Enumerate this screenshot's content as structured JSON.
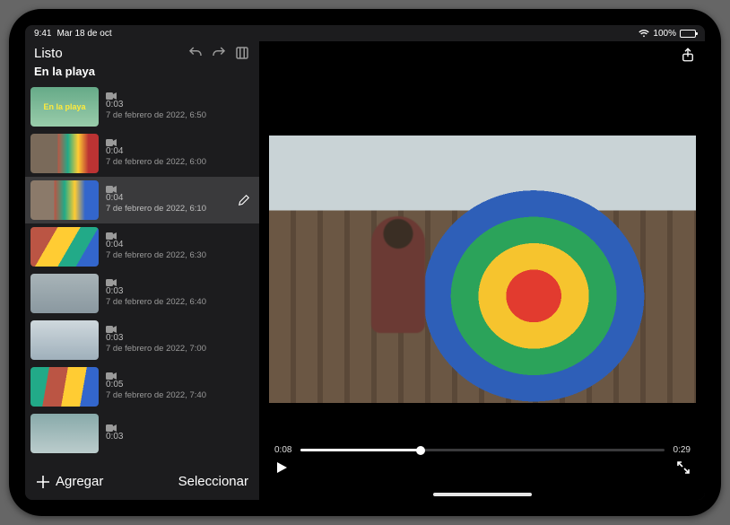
{
  "status": {
    "time": "9:41",
    "date": "Mar 18 de oct",
    "battery": "100%"
  },
  "sidebar": {
    "back_label": "Listo",
    "project_title": "En la playa",
    "add_label": "Agregar",
    "select_label": "Seleccionar",
    "clips": [
      {
        "duration": "0:03",
        "date": "7 de febrero de 2022, 6:50",
        "title": "En la playa"
      },
      {
        "duration": "0:04",
        "date": "7 de febrero de 2022, 6:00",
        "title": ""
      },
      {
        "duration": "0:04",
        "date": "7 de febrero de 2022, 6:10",
        "title": ""
      },
      {
        "duration": "0:04",
        "date": "7 de febrero de 2022, 6:30",
        "title": ""
      },
      {
        "duration": "0:03",
        "date": "7 de febrero de 2022, 6:40",
        "title": ""
      },
      {
        "duration": "0:03",
        "date": "7 de febrero de 2022, 7:00",
        "title": ""
      },
      {
        "duration": "0:05",
        "date": "7 de febrero de 2022, 7:40",
        "title": ""
      },
      {
        "duration": "0:03",
        "date": "",
        "title": ""
      }
    ],
    "selected_index": 2
  },
  "player": {
    "current_time": "0:08",
    "total_time": "0:29"
  }
}
